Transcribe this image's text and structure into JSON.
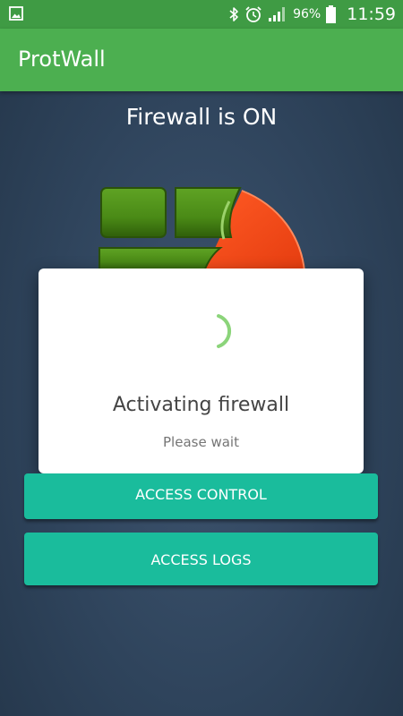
{
  "status_bar": {
    "battery_percent": "96%",
    "time": "11:59",
    "icons": [
      "gallery-icon",
      "bluetooth-icon",
      "alarm-icon",
      "signal-icon",
      "battery-icon"
    ]
  },
  "app": {
    "title": "ProtWall"
  },
  "main": {
    "firewall_status": "Firewall is ON"
  },
  "dialog": {
    "title": "Activating firewall",
    "subtitle": "Please wait"
  },
  "buttons": {
    "access_control": "ACCESS CONTROL",
    "access_logs": "ACCESS LOGS"
  },
  "colors": {
    "status_bar": "#3f9b44",
    "app_bar": "#4caf50",
    "button": "#1abc9c",
    "background": "#2f445c",
    "spinner": "#8bd47a",
    "brick_green": "#4e8f18",
    "shield_red": "#f04a1c"
  }
}
